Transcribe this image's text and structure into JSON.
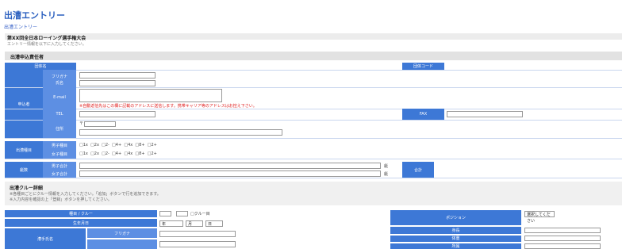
{
  "page": {
    "title": "出漕エントリー",
    "breadcrumb": "出漕エントリー"
  },
  "section1": {
    "event_title": "第XX回全日本ローイング選手権大会",
    "note": "エントリー情報を以下に入力してください。",
    "head": "出漕申込責任者"
  },
  "form1": {
    "col_label_left": "団体名",
    "col_label_right": "団体コード",
    "applicant_label": "申込者",
    "furigana_label": "フリガナ",
    "name_label": "氏名",
    "email_label": "E-mail",
    "email_error": "※自動返信先はこの欄に記載のアドレスに送信します。携帯キャリア等のアドレスはお控え下さい。",
    "tel_label": "TEL",
    "fax_label": "FAX",
    "address_label": "住所",
    "postal_mark": "〒",
    "events_label": "出漕種目",
    "men_label": "男子種目",
    "women_label": "女子種目",
    "men_events": [
      "1x",
      "2x",
      "2-",
      "4+",
      "4x",
      "8+",
      "2+"
    ],
    "women_events": [
      "1x",
      "2x",
      "2-",
      "4+",
      "4x",
      "8+",
      "2+"
    ],
    "boats_label": "艇数",
    "boats_men_label": "男子合計",
    "boats_women_label": "女子合計",
    "unit": "艇",
    "total_label": "合計"
  },
  "section2": {
    "title": "出漕クルー詳細",
    "note1": "※各種目ごとにクルー情報を入力してください。「追加」ボタンで行を追加できます。",
    "note2": "※入力内容を確認の上「登録」ボタンを押してください。"
  },
  "form2": {
    "crew_label": "種目 / クルー",
    "crew_unit": "クルー目",
    "date_label": "生年月日",
    "date_year": "年",
    "date_month": "月",
    "date_day": "日",
    "person_label": "漕手氏名",
    "furigana_label": "フリガナ",
    "right_label1": "ポジション",
    "right_select": "選択してください",
    "right_label2": "身長",
    "right_label3": "体重",
    "right_label4": "所属"
  }
}
